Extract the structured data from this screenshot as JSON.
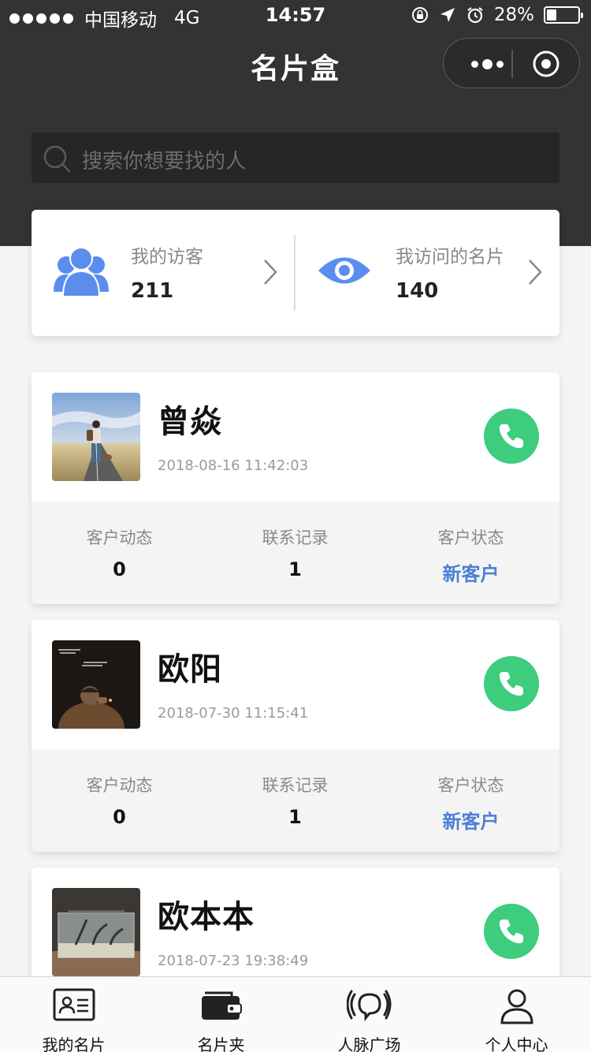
{
  "status_bar": {
    "carrier": "中国移动",
    "network": "4G",
    "time": "14:57",
    "battery": "28%",
    "battery_level": 0.28
  },
  "nav": {
    "title": "名片盒"
  },
  "search": {
    "placeholder": "搜索你想要找的人"
  },
  "stats": {
    "visitors": {
      "label": "我的访客",
      "value": "211"
    },
    "visited_cards": {
      "label": "我访问的名片",
      "value": "140"
    }
  },
  "contacts": [
    {
      "name": "曾焱",
      "time": "2018-08-16 11:42:03",
      "metrics": [
        {
          "label": "客户动态",
          "value": "0"
        },
        {
          "label": "联系记录",
          "value": "1"
        },
        {
          "label": "客户状态",
          "value": "新客户"
        }
      ]
    },
    {
      "name": "欧阳",
      "time": "2018-07-30 11:15:41",
      "metrics": [
        {
          "label": "客户动态",
          "value": "0"
        },
        {
          "label": "联系记录",
          "value": "1"
        },
        {
          "label": "客户状态",
          "value": "新客户"
        }
      ]
    },
    {
      "name": "欧本本",
      "time": "2018-07-23 19:38:49"
    }
  ],
  "tabbar": {
    "items": [
      {
        "label": "我的名片",
        "icon": "id-card-icon"
      },
      {
        "label": "名片夹",
        "icon": "wallet-icon"
      },
      {
        "label": "人脉广场",
        "icon": "broadcast-icon"
      },
      {
        "label": "个人中心",
        "icon": "person-icon"
      }
    ]
  },
  "colors": {
    "header_bg": "#333333",
    "accent_blue": "#4a7fd6",
    "icon_blue": "#5b8def",
    "call_green": "#3dcd7c"
  }
}
